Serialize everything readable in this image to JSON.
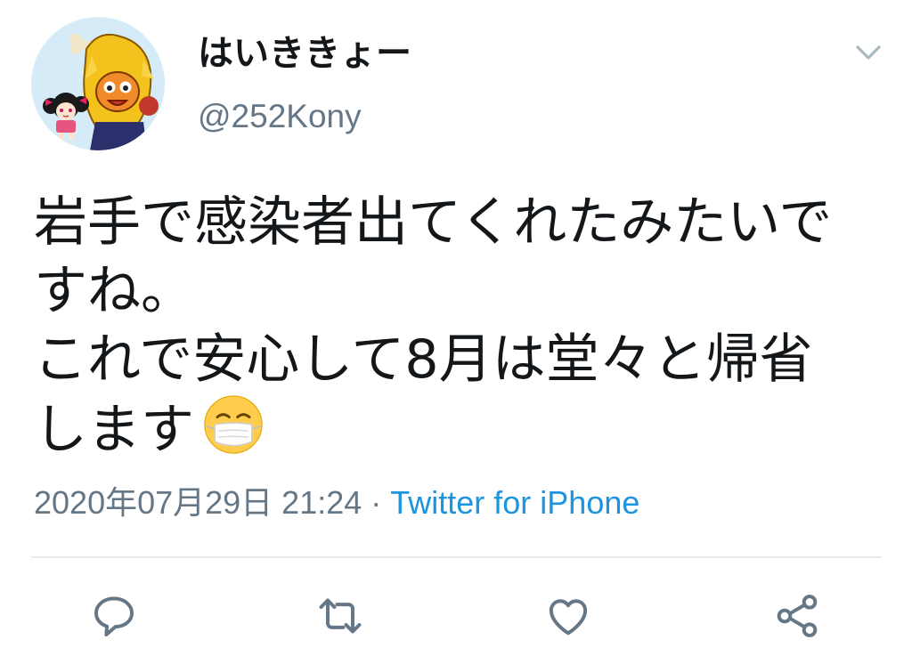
{
  "tweet": {
    "display_name": "はいききょー",
    "handle": "@252Kony",
    "body_lines": [
      "岩手で感染者出てくれたみたいで",
      "すね。",
      "これで安心して8月は堂々と帰省",
      "します"
    ],
    "trailing_emoji": "face-with-medical-mask",
    "timestamp": "2020年07月29日 21:24",
    "separator": "·",
    "source": "Twitter for iPhone"
  },
  "header": {
    "menu_icon": "chevron-down-icon"
  },
  "actions": [
    {
      "icon": "reply-icon"
    },
    {
      "icon": "retweet-icon"
    },
    {
      "icon": "heart-icon"
    },
    {
      "icon": "share-icon"
    }
  ],
  "colors": {
    "text": "#14171a",
    "secondary": "#657786",
    "link": "#1b95e0",
    "divider": "#e6ecf0",
    "avatar_bg": "#d5ebf7",
    "icon": "#657786"
  }
}
